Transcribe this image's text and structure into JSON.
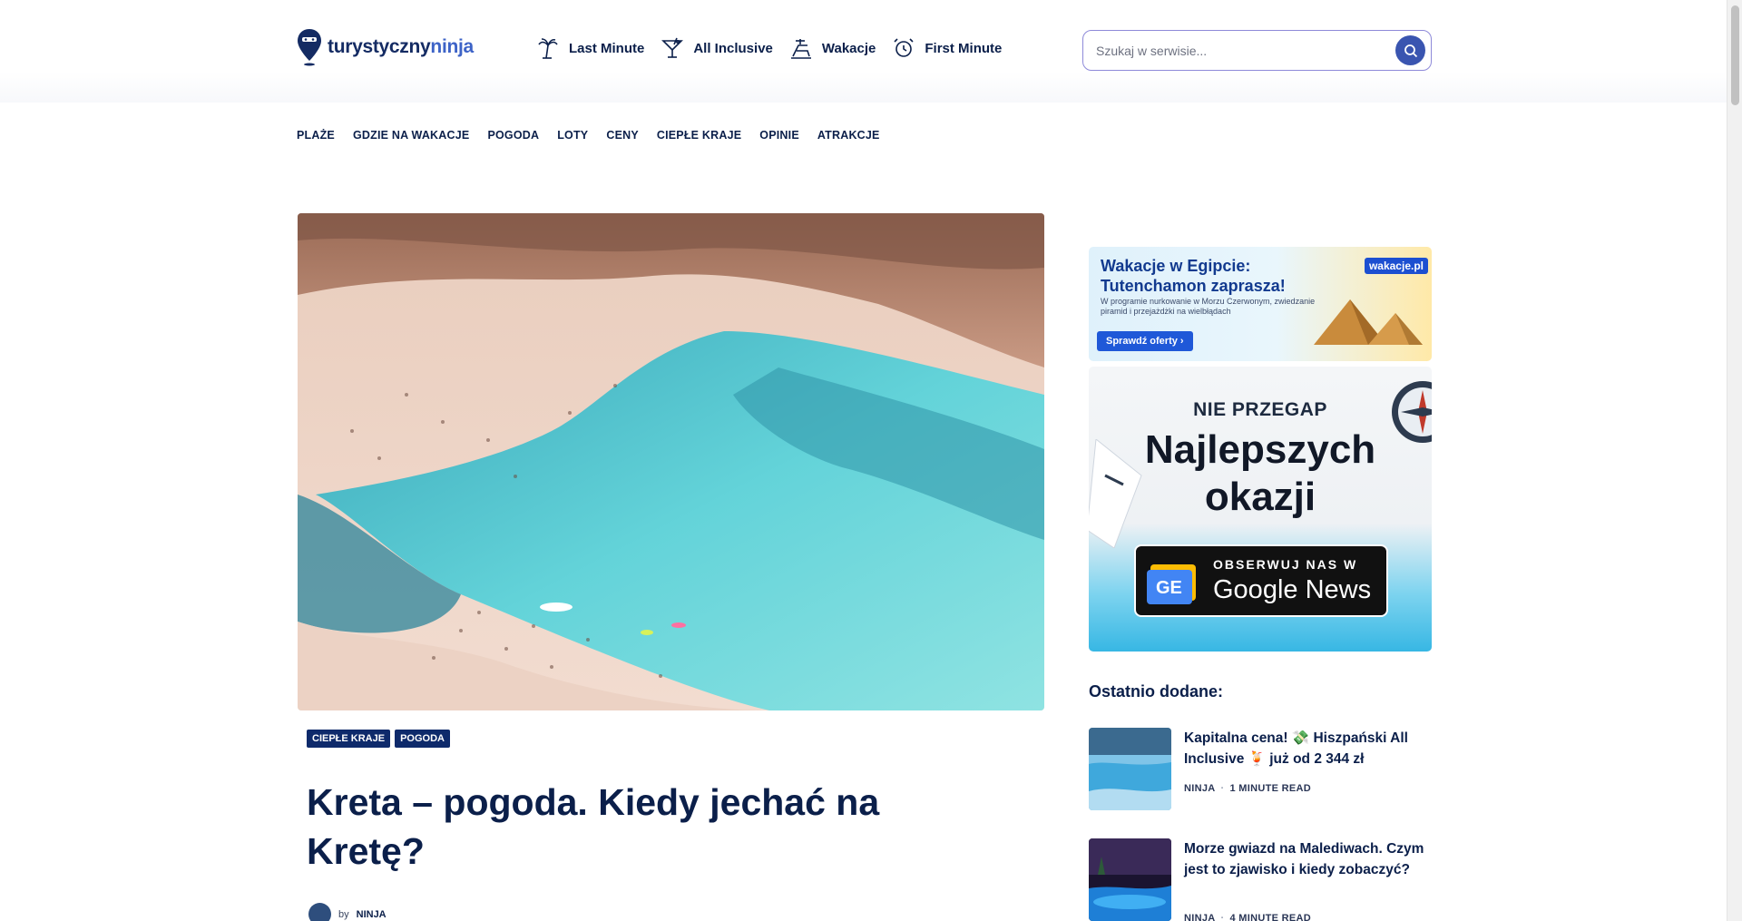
{
  "header": {
    "logo": {
      "part1": "turystyczny",
      "part2": "ninja"
    },
    "menu": [
      {
        "label": "Last Minute",
        "icon": "palm-tree-icon"
      },
      {
        "label": "All Inclusive",
        "icon": "cocktail-icon"
      },
      {
        "label": "Wakacje",
        "icon": "beach-chair-icon"
      },
      {
        "label": "First Minute",
        "icon": "clock-icon"
      }
    ],
    "search": {
      "placeholder": "Szukaj w serwisie..."
    }
  },
  "catnav": [
    "PLAŻE",
    "GDZIE NA WAKACJE",
    "POGODA",
    "LOTY",
    "CENY",
    "CIEPŁE KRAJE",
    "OPINIE",
    "ATRAKCJE"
  ],
  "article": {
    "tags": [
      "CIEPŁE KRAJE",
      "POGODA"
    ],
    "title": "Kreta – pogoda. Kiedy jechać na Kretę?",
    "by": "by",
    "author": "NINJA"
  },
  "sidebar": {
    "ad1": {
      "headline1": "Wakacje w Egipcie:",
      "headline2": "Tutenchamon zaprasza!",
      "sub": "W programie nurkowanie w Morzu Czerwonym, zwiedzanie piramid i przejażdżki na wielbłądach",
      "brand": "wakacje.pl",
      "cta": "Sprawdź oferty ›"
    },
    "ad2": {
      "line1": "NIE PRZEGAP",
      "line2": "Najlepszych",
      "line3": "okazji",
      "gn1": "OBSERWUJ NAS W",
      "gn2": "Google News"
    },
    "recent_heading": "Ostatnio dodane:",
    "posts": [
      {
        "title": "Kapitalna cena! 💸 Hiszpański All Inclusive 🍹 już od 2 344 zł",
        "author": "NINJA",
        "read": "1 MINUTE READ"
      },
      {
        "title": "Morze gwiazd na Malediwach. Czym jest to zjawisko i kiedy zobaczyć?",
        "author": "NINJA",
        "read": "4 MINUTE READ"
      }
    ]
  }
}
